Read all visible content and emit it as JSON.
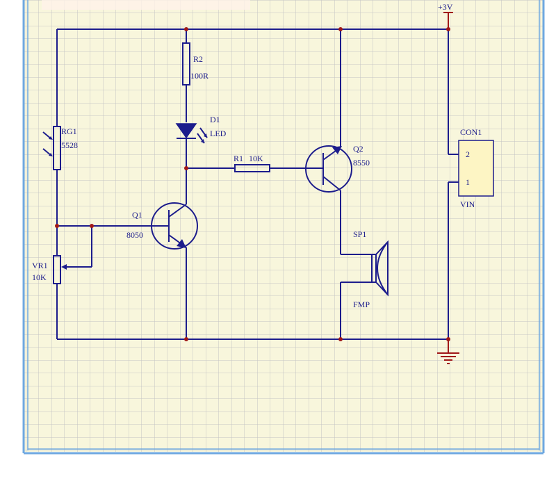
{
  "labels": {
    "vcc": "+3V",
    "r2_ref": "R2",
    "r2_val": "100R",
    "d1_ref": "D1",
    "d1_val": "LED",
    "rg1_ref": "RG1",
    "rg1_val": "5528",
    "r1_ref": "R1",
    "r1_val": "10K",
    "q2_ref": "Q2",
    "q2_val": "8550",
    "q1_ref": "Q1",
    "q1_val": "8050",
    "vr1_ref": "VR1",
    "vr1_val": "10K",
    "sp1_ref": "SP1",
    "sp1_val": "FMP",
    "con1_ref": "CON1",
    "con1_val": "VIN",
    "pin2": "2",
    "pin1": "1"
  },
  "colors": {
    "grid_bg": "#f8f6dc",
    "grid_line": "#c4c4c4",
    "frame": "#6fa8e0",
    "wire": "#1c1c8c",
    "junction": "#a01818",
    "connector_fill": "#fdf5c4"
  }
}
